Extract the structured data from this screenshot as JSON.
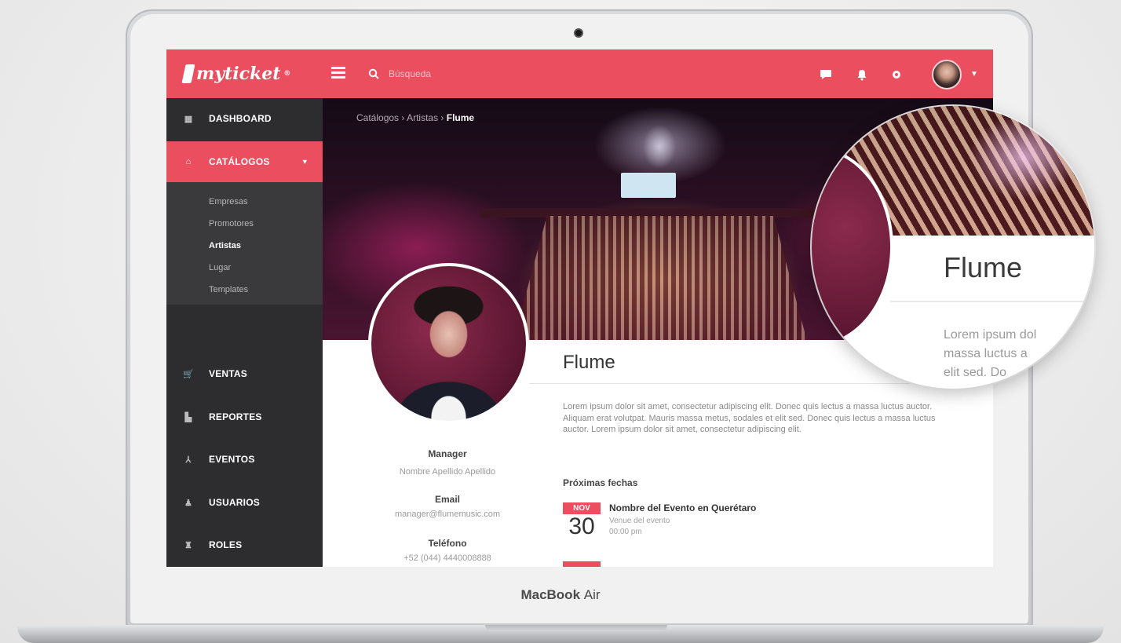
{
  "device": {
    "brand": "MacBook",
    "model": "Air"
  },
  "app": {
    "logo_text": "myticket",
    "logo_mark": "®"
  },
  "topbar": {
    "search_placeholder": "Búsqueda",
    "icons": [
      "menu-icon",
      "search-icon",
      "chat-icon",
      "bell-icon",
      "gear-icon",
      "avatar",
      "chevron-down-icon"
    ]
  },
  "sidebar": {
    "items": [
      {
        "label": "DASHBOARD",
        "icon": "dashboard-icon"
      },
      {
        "label": "CATÁLOGOS",
        "icon": "home-icon",
        "active": true
      },
      {
        "label": "VENTAS",
        "icon": "cart-icon"
      },
      {
        "label": "REPORTES",
        "icon": "chart-icon"
      },
      {
        "label": "EVENTOS",
        "icon": "event-icon"
      },
      {
        "label": "USUARIOS",
        "icon": "user-icon"
      },
      {
        "label": "ROLES",
        "icon": "roles-icon"
      }
    ],
    "subitems": [
      {
        "label": "Empresas"
      },
      {
        "label": "Promotores"
      },
      {
        "label": "Artistas",
        "active": true
      },
      {
        "label": "Lugar"
      },
      {
        "label": "Templates"
      }
    ]
  },
  "breadcrumb": {
    "part1": "Catálogos",
    "sep": "›",
    "part2": "Artistas",
    "current": "Flume"
  },
  "artist": {
    "name": "Flume",
    "bio": "Lorem ipsum dolor sit amet, consectetur adipiscing elit. Donec quis lectus a massa luctus auctor. Aliquam erat volutpat. Mauris massa metus, sodales et elit sed. Donec quis lectus a massa luctus auctor. Lorem ipsum dolor sit amet, consectetur adipiscing elit.",
    "manager_label": "Manager",
    "manager_value": "Nombre Apellido Apellido",
    "email_label": "Email",
    "email_value": "manager@flumemusic.com",
    "phone_label": "Teléfono",
    "phone_value": "+52 (044) 4440008888"
  },
  "upcoming": {
    "title": "Próximas fechas",
    "events": [
      {
        "month": "NOV",
        "day": "30",
        "name": "Nombre del Evento en Querétaro",
        "venue": "Venue del evento",
        "time": "00:00 pm"
      }
    ]
  },
  "magnifier": {
    "name": "Flume",
    "bio_lines": [
      "Lorem ipsum dol",
      "massa luctus a",
      "elit sed. Do"
    ]
  },
  "colors": {
    "accent": "#ea4e5f",
    "sidebar": "#2d2d2f",
    "subnav": "#3a3a3d"
  }
}
